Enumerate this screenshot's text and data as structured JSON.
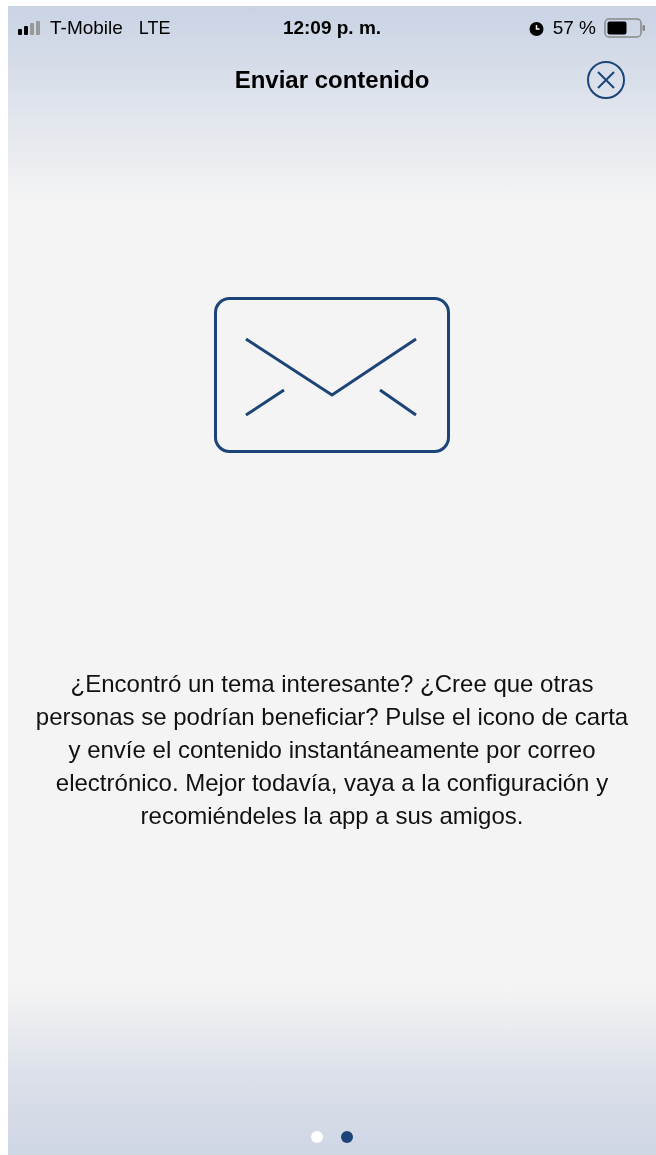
{
  "status_bar": {
    "carrier": "T-Mobile",
    "network": "LTE",
    "time": "12:09 p. m.",
    "battery": "57 %"
  },
  "header": {
    "title": "Enviar contenido"
  },
  "body": {
    "text": "¿Encontró un tema interesante? ¿Cree que otras personas se podrían beneficiar? Pulse el icono de carta y envíe el contenido instantáneamente por correo electrónico. Mejor todavía, vaya a la configuración y recomiéndeles la app a sus amigos."
  },
  "page_dots": [
    {
      "selected": false
    },
    {
      "selected": true
    }
  ]
}
